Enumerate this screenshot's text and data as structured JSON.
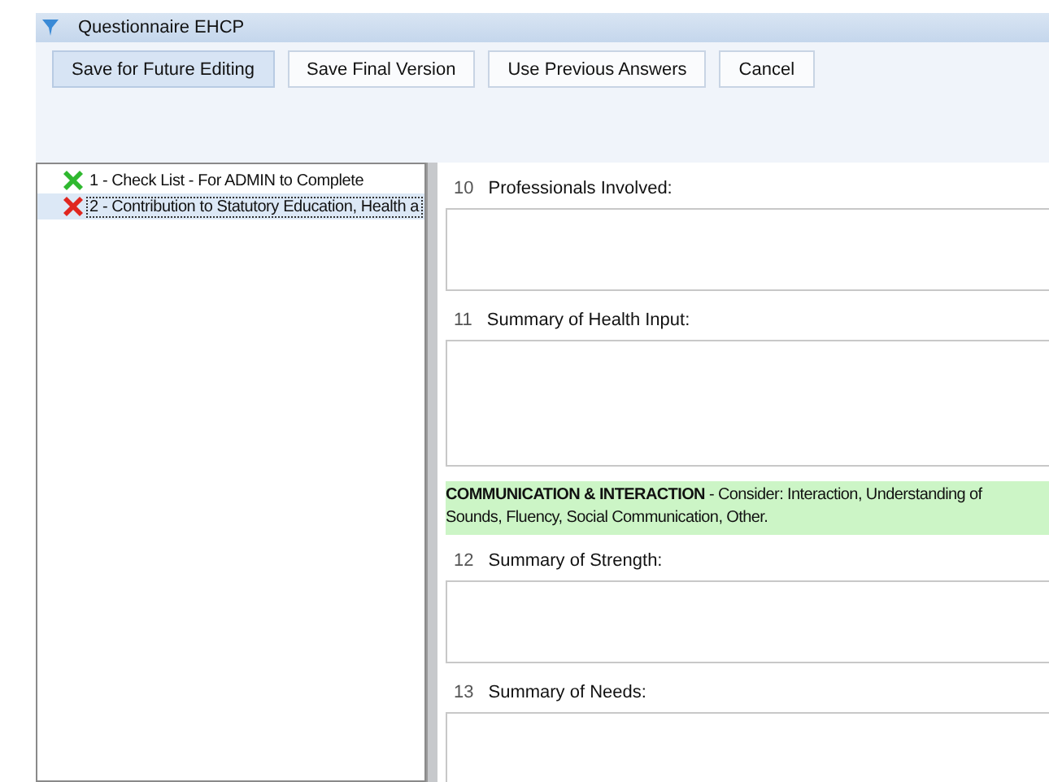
{
  "window": {
    "title": "Questionnaire EHCP"
  },
  "toolbar": {
    "buttons": [
      {
        "label": "Save for Future Editing",
        "selected": true
      },
      {
        "label": "Save Final Version",
        "selected": false
      },
      {
        "label": "Use Previous Answers",
        "selected": false
      },
      {
        "label": "Cancel",
        "selected": false
      }
    ]
  },
  "sidebar": {
    "items": [
      {
        "label": "1 - Check List - For ADMIN to Complete",
        "color": "#2fb82f",
        "selected": false
      },
      {
        "label": "2 - Contribution to Statutory Education, Health a",
        "color": "#e0261f",
        "selected": true
      }
    ]
  },
  "form": {
    "items": [
      {
        "kind": "question",
        "number": "10",
        "label": "Professionals Involved:"
      },
      {
        "kind": "longquestion",
        "number": "11",
        "label": "Summary of Health Input:"
      },
      {
        "kind": "section",
        "lines": [
          "**COMMUNICATION & INTERACTION**  - Consider: Interaction, Understanding of",
          "Sounds, Fluency, Social Communication, Other."
        ]
      },
      {
        "kind": "question",
        "number": "12",
        "label": "Summary of Strength:"
      },
      {
        "kind": "question",
        "number": "13",
        "label": "Summary of Needs:"
      }
    ]
  }
}
